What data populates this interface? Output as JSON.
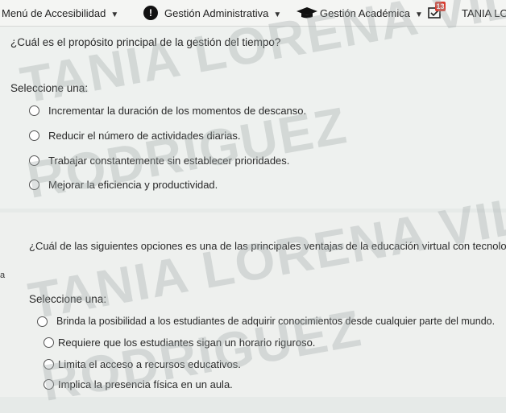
{
  "topbar": {
    "menu_accesibilidad": "Menú de Accesibilidad",
    "gestion_administrativa": "Gestión Administrativa",
    "gestion_academica": "Gestión Académica",
    "notification_count": "13",
    "user_name": "TANIA LOREN"
  },
  "question1": {
    "text": "¿Cuál es el propósito principal de la gestión del tiempo?",
    "select_label": "Seleccione una:",
    "options": [
      "Incrementar la duración de los momentos de descanso.",
      "Reducir el número de actividades diarias.",
      "Trabajar constantemente sin establecer prioridades.",
      "Mejorar la eficiencia y productividad."
    ]
  },
  "question2": {
    "text": "¿Cuál de las siguientes opciones es una de las principales ventajas de la educación virtual con tecnología?",
    "side_mark": "a",
    "select_label": "Seleccione una:",
    "options": [
      "Brinda la posibilidad a los estudiantes de adquirir conocimientos desde cualquier parte del mundo.",
      "Requiere que los estudiantes sigan un horario riguroso.",
      "Limita el acceso a recursos educativos.",
      "Implica la presencia física en un aula."
    ]
  },
  "watermark": {
    "line1": "TANIA LORENA VILLALO",
    "line2": "RODRIGUEZ"
  },
  "colors": {
    "badge": "#d83b2f",
    "panel": "#eef1ef"
  }
}
